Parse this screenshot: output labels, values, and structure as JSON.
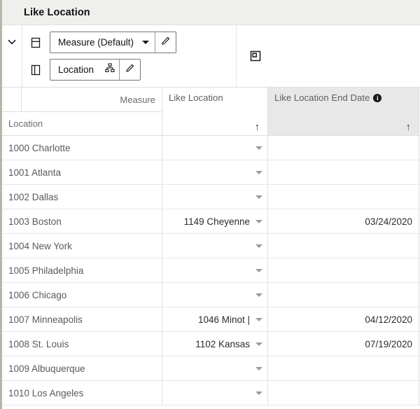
{
  "window": {
    "title": "Like Location"
  },
  "toolbar": {
    "collapse_icon": "chevron-down-icon",
    "rows_shelf": {
      "icon": "rows-layout-icon",
      "pill_label": "Measure (Default)",
      "dropdown_icon": "caret-down-icon",
      "edit_icon": "pencil-icon"
    },
    "columns_shelf": {
      "icon": "columns-layout-icon",
      "pill_label": "Location",
      "hierarchy_icon": "hierarchy-icon",
      "edit_icon": "pencil-icon"
    },
    "panel_icon": "panel-layout-icon"
  },
  "grid": {
    "corner": {
      "measure_label": "Measure",
      "location_label": "Location"
    },
    "columns": [
      {
        "label": "Like Location",
        "sort_indicator": "↑",
        "has_info": false,
        "highlighted": false
      },
      {
        "label": "Like Location End Date",
        "sort_indicator": "↑",
        "has_info": true,
        "info_glyph": "i",
        "highlighted": true
      }
    ],
    "rows": [
      {
        "location": "1000 Charlotte",
        "like_location": "",
        "end_date": ""
      },
      {
        "location": "1001 Atlanta",
        "like_location": "",
        "end_date": ""
      },
      {
        "location": "1002 Dallas",
        "like_location": "",
        "end_date": ""
      },
      {
        "location": "1003 Boston",
        "like_location": "1149 Cheyenne",
        "end_date": "03/24/2020"
      },
      {
        "location": "1004 New York",
        "like_location": "",
        "end_date": ""
      },
      {
        "location": "1005 Philadelphia",
        "like_location": "",
        "end_date": ""
      },
      {
        "location": "1006 Chicago",
        "like_location": "",
        "end_date": ""
      },
      {
        "location": "1007 Minneapolis",
        "like_location": "1046 Minot |",
        "end_date": "04/12/2020"
      },
      {
        "location": "1008 St. Louis",
        "like_location": "1102 Kansas",
        "end_date": "07/19/2020"
      },
      {
        "location": "1009 Albuquerque",
        "like_location": "",
        "end_date": ""
      },
      {
        "location": "1010 Los Angeles",
        "like_location": "",
        "end_date": ""
      }
    ]
  },
  "colors": {
    "titlebar_bg": "#efefed",
    "header_highlight_bg": "#e8e8e8",
    "border": "#dededd",
    "text_muted": "#5a5a5a",
    "text_dark": "#2b2b2b"
  }
}
